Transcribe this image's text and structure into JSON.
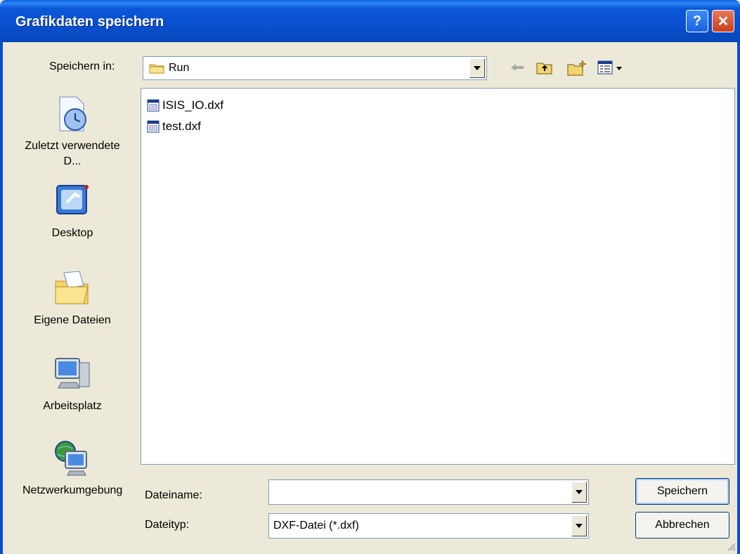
{
  "window": {
    "title": "Grafikdaten speichern",
    "help_glyph": "?",
    "close_glyph": "✕"
  },
  "save_in": {
    "label": "Speichern in:",
    "value": "Run"
  },
  "places": [
    {
      "label": "Zuletzt verwendete D...",
      "icon": "recent-documents-icon"
    },
    {
      "label": "Desktop",
      "icon": "desktop-icon"
    },
    {
      "label": "Eigene Dateien",
      "icon": "my-documents-icon"
    },
    {
      "label": "Arbeitsplatz",
      "icon": "my-computer-icon"
    },
    {
      "label": "Netzwerkumgebung",
      "icon": "network-places-icon"
    }
  ],
  "files": [
    {
      "name": "ISIS_IO.dxf",
      "icon": "dxf-file-icon"
    },
    {
      "name": "test.dxf",
      "icon": "dxf-file-icon"
    }
  ],
  "filename": {
    "label": "Dateiname:",
    "value": ""
  },
  "filetype": {
    "label": "Dateityp:",
    "value": "DXF-Datei (*.dxf)"
  },
  "buttons": {
    "save": "Speichern",
    "cancel": "Abbrechen"
  },
  "colors": {
    "titlebar": "#0a4fd0",
    "dialog_bg": "#ece9d8",
    "border": "#7f9db9"
  }
}
